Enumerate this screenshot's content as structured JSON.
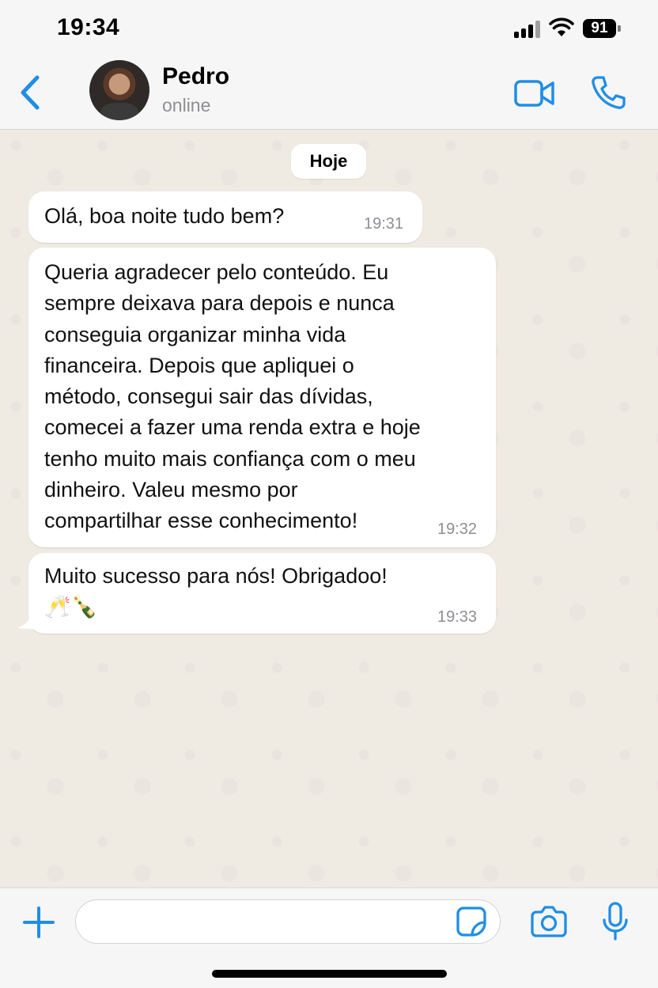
{
  "status_bar": {
    "time": "19:34",
    "battery": "91"
  },
  "header": {
    "contact_name": "Pedro",
    "contact_status": "online"
  },
  "chat": {
    "date_label": "Hoje",
    "messages": [
      {
        "text": "Olá, boa noite tudo bem?",
        "time": "19:31"
      },
      {
        "text": "Queria agradecer pelo conteúdo. Eu\nsempre deixava para depois e nunca\nconseguia organizar minha vida\nfinanceira. Depois que apliquei o\nmétodo, consegui sair das dívidas,\ncomecei a fazer uma renda extra e hoje\ntenho muito mais confiança com o meu\ndinheiro. Valeu mesmo por\ncompartilhar esse conhecimento!",
        "time": "19:32"
      },
      {
        "text": "Muito sucesso para nós! Obrigadoo!\n🥂🍾",
        "time": "19:33"
      }
    ]
  },
  "input_bar": {
    "placeholder": ""
  },
  "icons": {
    "back": "chevron-left-icon",
    "video": "video-camera-icon",
    "call": "phone-icon",
    "plus": "plus-icon",
    "sticker": "sticker-icon",
    "camera": "camera-icon",
    "mic": "microphone-icon"
  },
  "colors": {
    "accent": "#1f8ee6",
    "chat_background": "#efeae2",
    "bubble": "#ffffff",
    "timestamp": "#8e8e93"
  }
}
